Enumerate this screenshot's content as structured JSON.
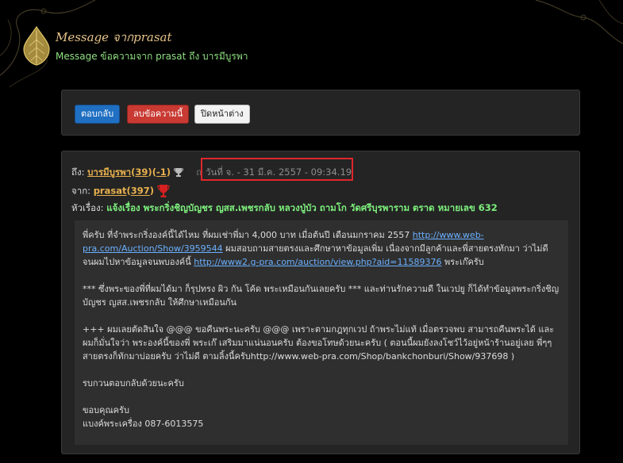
{
  "header": {
    "title": "Message จากprasat",
    "subtitle": "Message ข้อความจาก prasat ถึง บารมีบูรพา"
  },
  "toolbar": {
    "reply_label": "ตอบกลับ",
    "delete_label": "ลบข้อความนี้",
    "close_label": "ปิดหน้าต่าง"
  },
  "message": {
    "to_label": "ถึง:",
    "to_user": "บารมีบูรพา",
    "to_score_open": "(",
    "to_score": "39",
    "to_score_close": ")",
    "to_neg_open": "(",
    "to_neg": "-1",
    "to_neg_close": ")",
    "date_prefix": "ถ",
    "date": "วันที่ จ. - 31 มี.ค. 2557 - 09:34.19",
    "from_label": "จาก:",
    "from_user": "prasat",
    "from_score_open": "(",
    "from_score": "397",
    "from_score_close": ")",
    "subject_label": "หัวเรื่อง:",
    "subject": "แจ้งเรื่อง พระกริ่งชิญบัญชร ญสส.เพชรกลับ หลวงปู่บัว ถามโก วัดศรีบุรพาราม ตราด หมายเลข 632",
    "body": {
      "p1_a": "พี่ครับ ที่จำพระกริ่งองค์นี้ได้ไหม ที่ผมเช่าพี่มา 4,000 บาท เมื่อต้นปี เดือนมกราคม 2557 ",
      "p1_link1": "http://www.web-pra.com/Auction/Show/3959544",
      "p1_b": " ผมสอบถามสายตรงและศึกษาหาข้อมูลเพิ่ม เนื่องจากมีลูกค้าและพี่สายตรงทักมา ว่าไม่ดี จนผมไปหาข้อมูลจนพบองค์นี้ ",
      "p1_link2": "http://www2.g-pra.com/auction/view.php?aid=11589376",
      "p1_c": " พระเก๊ครับ",
      "p2": "*** ซึ่งพระของพี่ที่ผมได้มา ก็รุปทรง ผิว กัน โค้ด พระเหมือนกันเลยครับ  *** และท่านรักความดี ในเวปยู ก็ได้ทำข้อมูลพระกริ่งชิญบัญชร ญสส.เพชรกลับ ให้ศึกษาเหมือนกัน",
      "p3": "+++ ผมเลยตัดสินใจ @@@  ขอคืนพระนะครับ @@@ เพราะตามกฎทุกเวป ถ้าพระไม่แท้ เมื่อตรวจพบ สามารถคืนพระได้ และผมก็มั่นใจว่า พระองค์นี้ของพี่ พระเก๊ เสริมมาแน่นอนครับ ต้องขอโทษด้วยนะครับ ( ตอนนี้ผมยังลงโชว์ไว้อยู่หน้าร้านอยู่เลย พี่ๆๆสายตรงก็ทักมาบ่อยครับ ว่าไม่ดี ตามลิ้งนี้ครับhttp://www.web-pra.com/Shop/bankchonburi/Show/937698 )",
      "p4": "รบกวนตอบกลับด้วยนะครับ",
      "p5": "ขอบคุณครับ",
      "p6": "แบงค์พระเครื่อง 087-6013575"
    }
  },
  "colors": {
    "background": "#000000",
    "panel": "#242424",
    "title_gold": "#e6c38a",
    "subtitle_green": "#8fe082",
    "reply_blue": "#1f6fc2",
    "delete_red": "#c83a32",
    "highlight_red": "#e0262c",
    "user_orange": "#e8b14e",
    "subject_green": "#7df07d"
  },
  "icons": [
    "lotus-leaf-logo-icon",
    "trophy-icon",
    "red-trophy-icon"
  ]
}
